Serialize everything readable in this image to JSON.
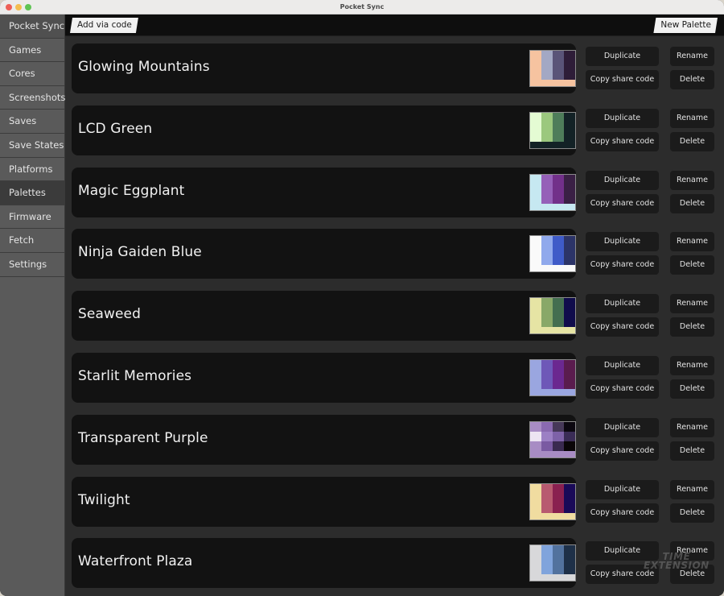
{
  "window": {
    "title": "Pocket Sync"
  },
  "toolbar": {
    "add_via_code_label": "Add via code",
    "new_palette_label": "New Palette"
  },
  "sidebar": {
    "header": "Pocket Sync",
    "active": "Palettes",
    "items": [
      {
        "label": "Games"
      },
      {
        "label": "Cores"
      },
      {
        "label": "Screenshots"
      },
      {
        "label": "Saves"
      },
      {
        "label": "Save States"
      },
      {
        "label": "Platforms"
      },
      {
        "label": "Palettes"
      },
      {
        "label": "Firmware"
      },
      {
        "label": "Fetch"
      },
      {
        "label": "Settings"
      }
    ]
  },
  "actions": {
    "duplicate": "Duplicate",
    "copy_share_code": "Copy share code",
    "rename": "Rename",
    "delete": "Delete"
  },
  "palettes": [
    {
      "name": "Glowing Mountains",
      "colors": [
        "#f6c3a0",
        "#a3a8c4",
        "#5a5478",
        "#2e1d38"
      ],
      "background": "#f6c3a0"
    },
    {
      "name": "LCD Green",
      "colors": [
        "#e4fbd3",
        "#9bc87e",
        "#4e7d5a",
        "#132226"
      ],
      "background": "#132226"
    },
    {
      "name": "Magic Eggplant",
      "colors": [
        "#c6e8f1",
        "#9560b8",
        "#72308a",
        "#3a2045"
      ],
      "background": "#c6e8f1"
    },
    {
      "name": "Ninja Gaiden Blue",
      "colors": [
        "#fafafa",
        "#90a9ec",
        "#3f5bc8",
        "#2c3468"
      ],
      "background": "#fafafa"
    },
    {
      "name": "Seaweed",
      "colors": [
        "#e6e4a4",
        "#89a868",
        "#446e50",
        "#100c4c"
      ],
      "background": "#e6e4a4"
    },
    {
      "name": "Starlit Memories",
      "colors": [
        "#9aa6e0",
        "#6e58b8",
        "#6b2890",
        "#5a1c4e"
      ],
      "background": "#9aa6e0"
    },
    {
      "name": "Transparent Purple",
      "grid": [
        [
          "#a88cc4",
          "#8a6ab0",
          "#463858",
          "#0c0810"
        ],
        [
          "#ece4f2",
          "#9c80c4",
          "#7e62a8",
          "#3a2c56"
        ],
        [
          "#a88cc4",
          "#7a5aa2",
          "#3a2a50",
          "#0a0608"
        ]
      ],
      "background": "#a88cc4"
    },
    {
      "name": "Twilight",
      "colors": [
        "#f0dca0",
        "#b85a70",
        "#8a2050",
        "#1a0a58"
      ],
      "background": "#f0dca0"
    },
    {
      "name": "Waterfront Plaza",
      "colors": [
        "#d8d8da",
        "#80a4dc",
        "#52729e",
        "#1e3048"
      ],
      "background": "#d8d8da"
    }
  ],
  "watermark": {
    "line1": "TIME",
    "line2": "EXTENSION"
  }
}
